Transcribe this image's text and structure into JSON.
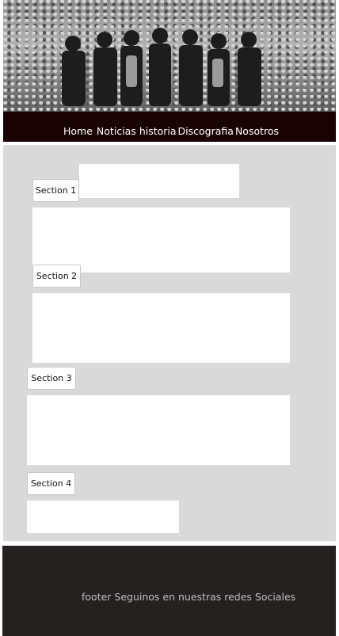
{
  "hero": {
    "image_name": "concert-crowd-photo-icon"
  },
  "nav": {
    "items": [
      "Home",
      "Noticias",
      "historia",
      "Discografia",
      "Nosotros"
    ]
  },
  "sections": [
    {
      "label": "Section 1"
    },
    {
      "label": "Section 2"
    },
    {
      "label": "Section 3"
    },
    {
      "label": "Section 4"
    }
  ],
  "footer": {
    "text": "footer Seguinos en nuestras redes Sociales"
  },
  "colors": {
    "nav_bg": "#1a0303",
    "main_bg": "#d9d9d9",
    "footer_bg": "#252120",
    "footer_text": "#bdbdbd"
  }
}
